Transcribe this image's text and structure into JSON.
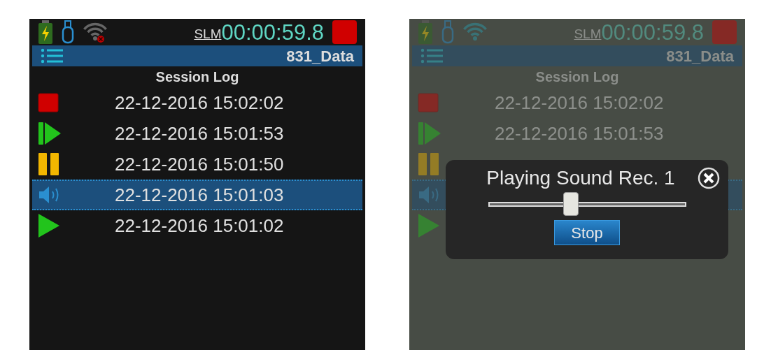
{
  "screens": [
    {
      "status_bar": {
        "wifi_connected": false,
        "mode": "SLM",
        "timer": "00:00:59.8"
      },
      "title_bar": {
        "title": "831_Data"
      },
      "heading": "Session Log",
      "dimmed": false,
      "log": [
        {
          "kind": "stop",
          "time": "22-12-2016 15:02:02",
          "selected": false
        },
        {
          "kind": "resume",
          "time": "22-12-2016 15:01:53",
          "selected": false
        },
        {
          "kind": "pause",
          "time": "22-12-2016 15:01:50",
          "selected": false
        },
        {
          "kind": "sound",
          "time": "22-12-2016 15:01:03",
          "selected": true
        },
        {
          "kind": "play",
          "time": "22-12-2016 15:01:02",
          "selected": false
        }
      ]
    },
    {
      "status_bar": {
        "wifi_connected": true,
        "mode": "SLM",
        "timer": "00:00:59.8"
      },
      "title_bar": {
        "title": "831_Data"
      },
      "heading": "Session Log",
      "dimmed": true,
      "log": [
        {
          "kind": "stop",
          "time": "22-12-2016 15:02:02",
          "selected": false
        },
        {
          "kind": "resume",
          "time": "22-12-2016 15:01:53",
          "selected": false
        },
        {
          "kind": "pause",
          "selected": false
        },
        {
          "kind": "sound",
          "selected": true
        },
        {
          "kind": "play",
          "selected": false
        }
      ],
      "dialog": {
        "title": "Playing Sound Rec. 1",
        "slider": {
          "level": 0.42
        },
        "button": "Stop"
      }
    }
  ]
}
